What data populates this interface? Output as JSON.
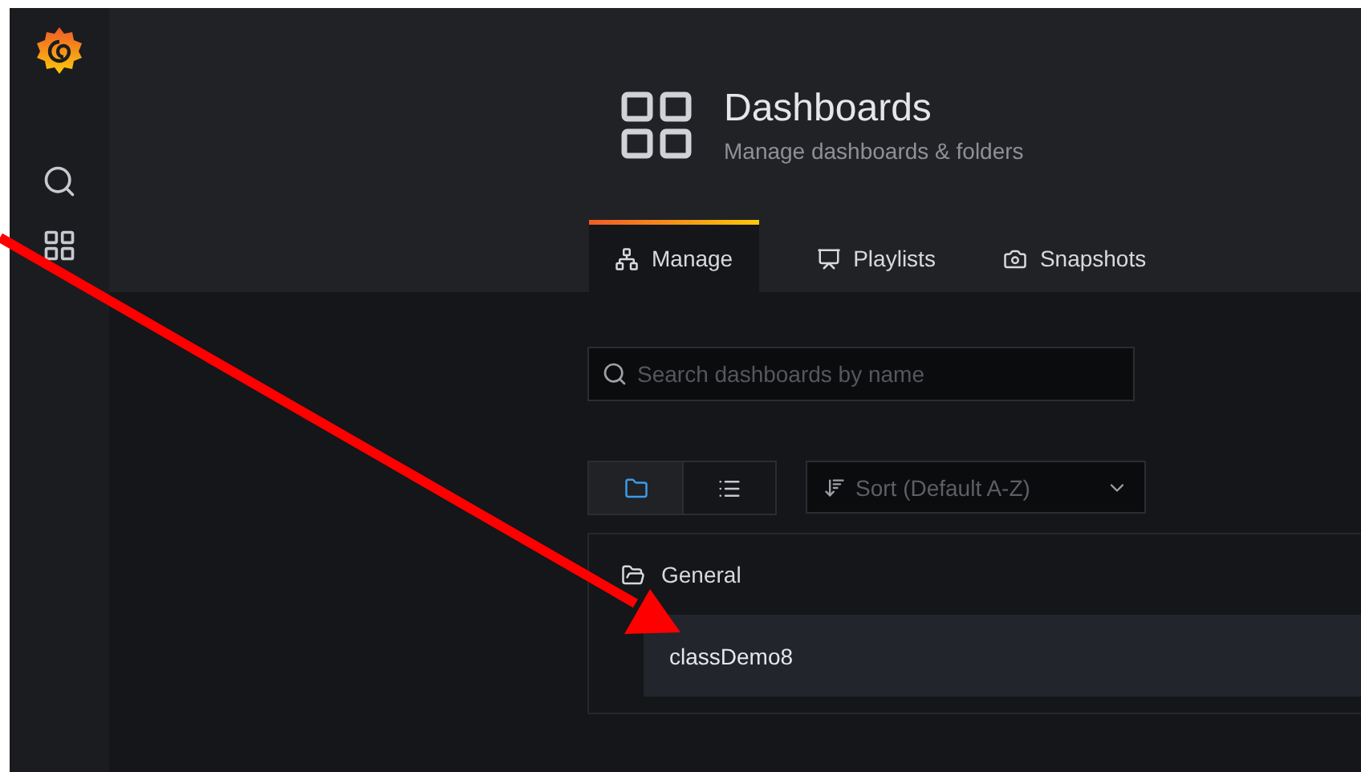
{
  "sidebar": {
    "items": [
      {
        "kind": "search",
        "selected": false
      },
      {
        "kind": "dashboards",
        "selected": false
      }
    ]
  },
  "header": {
    "title": "Dashboards",
    "subtitle": "Manage dashboards & folders"
  },
  "tabs": [
    {
      "label": "Manage",
      "kind": "sitemap",
      "selected": true
    },
    {
      "label": "Playlists",
      "kind": "presentation",
      "selected": false
    },
    {
      "label": "Snapshots",
      "kind": "camera",
      "selected": false
    }
  ],
  "search": {
    "placeholder": "Search dashboards by name"
  },
  "view_toggle": [
    {
      "kind": "folders",
      "selected": true
    },
    {
      "kind": "list",
      "selected": false
    }
  ],
  "sort": {
    "placeholder": "Sort (Default A-Z)"
  },
  "folders": [
    {
      "name": "General",
      "dashboards": [
        {
          "name": "classDemo8"
        }
      ]
    }
  ],
  "annotation": {
    "kind": "arrow"
  }
}
